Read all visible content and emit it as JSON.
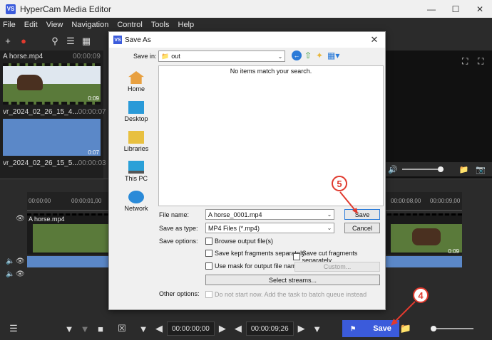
{
  "app": {
    "icon_text": "VS",
    "title": "HyperCam Media Editor"
  },
  "menu": [
    "File",
    "Edit",
    "View",
    "Navigation",
    "Control",
    "Tools",
    "Help"
  ],
  "media": [
    {
      "name": "A horse.mp4",
      "duration": "00:00:09",
      "badge": "0:09"
    },
    {
      "name": "vr_2024_02_26_15_4...",
      "duration": "00:00:07",
      "badge": "0:07"
    },
    {
      "name": "vr_2024_02_26_15_5...",
      "duration": "00:00:03"
    }
  ],
  "timeline": {
    "ruler_ticks": [
      "00:00:00",
      "00:00:01,00",
      "00:00:08,00",
      "00:00:09,00"
    ],
    "track_label": "A horse.mp4",
    "track_duration": "0:09"
  },
  "bottom": {
    "time_start": "00:00:00;00",
    "time_end": "00:00:09;26",
    "save_label": "Save"
  },
  "dialog": {
    "icon_text": "VS",
    "title": "Save As",
    "save_in_label": "Save in:",
    "save_in_value": "out",
    "places": [
      "Home",
      "Desktop",
      "Libraries",
      "This PC",
      "Network"
    ],
    "empty_message": "No items match your search.",
    "file_name_label": "File name:",
    "file_name_value": "A horse_0001.mp4",
    "save_as_type_label": "Save as type:",
    "save_as_type_value": "MP4 Files (*.mp4)",
    "save_button": "Save",
    "cancel_button": "Cancel",
    "save_options_label": "Save options:",
    "browse_output": "Browse output file(s)",
    "save_kept": "Save kept fragments separately",
    "save_cut": "Save cut fragments separately",
    "use_mask": "Use mask for output file names",
    "custom_button": "Custom...",
    "select_streams": "Select streams...",
    "other_options_label": "Other options:",
    "do_not_start": "Do not start now. Add the task to batch queue instead"
  },
  "callouts": {
    "step5": "5",
    "step4": "4"
  },
  "colors": {
    "accent": "#3b5bdb",
    "callout": "#e03a2e"
  }
}
